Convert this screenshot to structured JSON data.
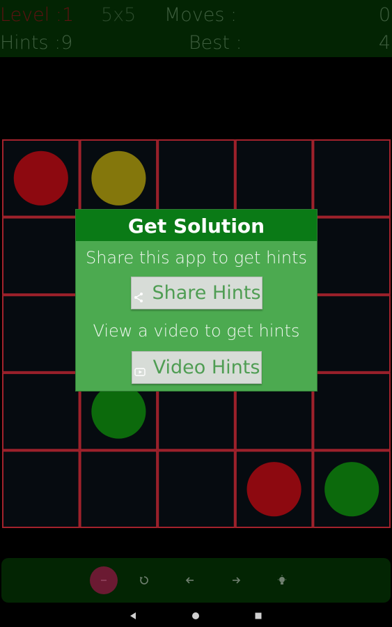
{
  "header": {
    "level_text": "Level :1",
    "size_text": "5x5",
    "moves_label": "Moves :",
    "moves_value": "0",
    "hints_text": "Hints :9",
    "best_label": "Best :",
    "best_value": "4"
  },
  "board": {
    "rows": 5,
    "cols": 5,
    "grid_color": "#a3222c",
    "background": "#060b10",
    "dots": [
      {
        "row": 0,
        "col": 0,
        "color": "#8d0910"
      },
      {
        "row": 0,
        "col": 1,
        "color": "#84770c"
      },
      {
        "row": 3,
        "col": 1,
        "color": "#0c6a0c"
      },
      {
        "row": 4,
        "col": 3,
        "color": "#8d0910"
      },
      {
        "row": 4,
        "col": 4,
        "color": "#0c6a0c"
      }
    ]
  },
  "dialog": {
    "title": "Get Solution",
    "share_prompt": "Share this app to get hints",
    "share_button": "Share Hints",
    "video_prompt": "View a video to get hints",
    "video_button": "Video Hints"
  },
  "toolbar": {
    "icons": [
      "minus-icon",
      "undo-icon",
      "arrow-left-icon",
      "arrow-right-icon",
      "bulb-icon"
    ]
  },
  "navbar": {
    "icons": [
      "back-icon",
      "home-icon",
      "recents-icon"
    ]
  }
}
